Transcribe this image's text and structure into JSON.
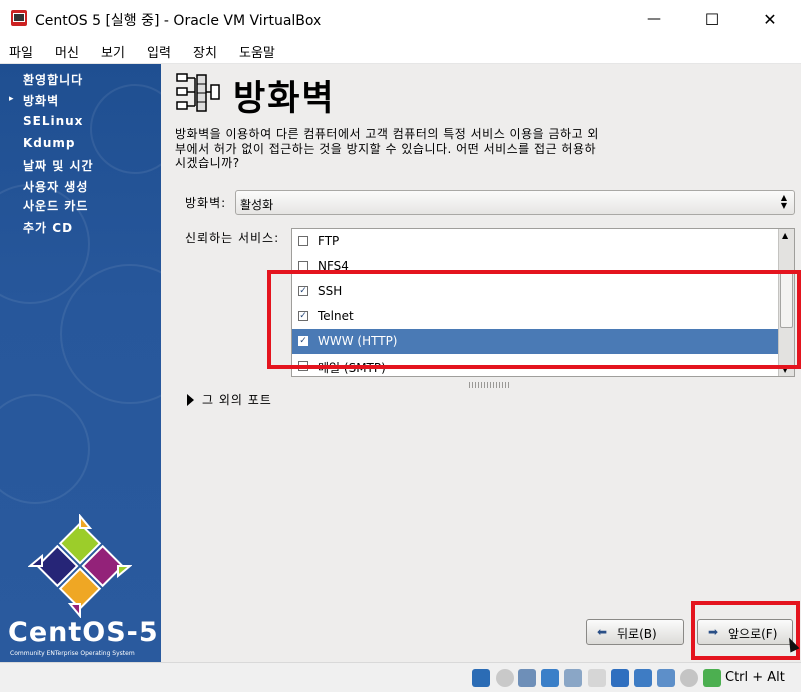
{
  "window": {
    "title": "CentOS 5 [실행 중] - Oracle VM VirtualBox",
    "minimize": "—",
    "maximize": "☐",
    "close": "✕"
  },
  "menu": [
    "파일",
    "머신",
    "보기",
    "입력",
    "장치",
    "도움말"
  ],
  "sidebar": {
    "items": [
      "환영합니다",
      "방화벽",
      "SELinux",
      "Kdump",
      "날짜 및 시간",
      "사용자 생성",
      "사운드 카드",
      "추가 CD"
    ],
    "current_index": 1,
    "logo_text": "CentOS-5",
    "logo_sub": "Community ENTerprise Operating System"
  },
  "page": {
    "title": "방화벽",
    "description_lines": [
      "방화벽을 이용하여 다른 컴퓨터에서 고객 컴퓨터의 특정 서비스 이용을 금하고 외",
      "부에서 허가 없이 접근하는 것을 방지할 수 있습니다. 어떤 서비스를 접근 허용하",
      "시겠습니까?"
    ],
    "firewall_label": "방화벽:",
    "firewall_value": "활성화",
    "services_label": "신뢰하는 서비스:",
    "services": [
      {
        "name": "FTP",
        "checked": false,
        "selected": false
      },
      {
        "name": "NFS4",
        "checked": false,
        "selected": false
      },
      {
        "name": "SSH",
        "checked": true,
        "selected": false
      },
      {
        "name": "Telnet",
        "checked": true,
        "selected": false
      },
      {
        "name": "WWW (HTTP)",
        "checked": true,
        "selected": true
      },
      {
        "name": "메일 (SMTP)",
        "checked": false,
        "selected": false
      }
    ],
    "other_ports_label": "그 외의 포트",
    "back_button": "뒤로(B)",
    "next_button": "앞으로(F)"
  },
  "statusbar": {
    "host_key": "Ctrl + Alt"
  },
  "colors": {
    "sidebar_blue": "#27579b",
    "selection_blue": "#4a7ab5",
    "highlight_red": "#e4141e"
  }
}
